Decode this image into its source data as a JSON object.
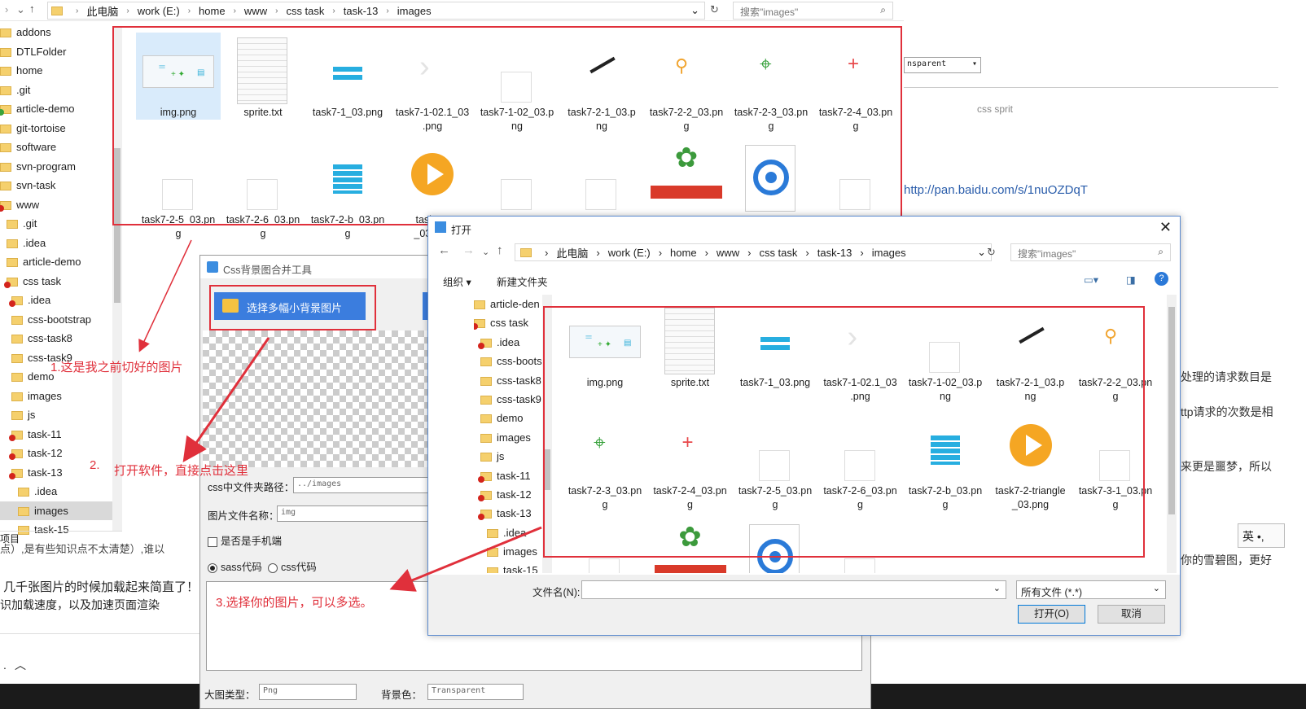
{
  "explorer": {
    "breadcrumbs": [
      "此电脑",
      "work (E:)",
      "home",
      "www",
      "css task",
      "task-13",
      "images"
    ],
    "search_placeholder": "搜索\"images\"",
    "tree": [
      {
        "label": "addons",
        "icon": "folder-icon"
      },
      {
        "label": "DTLFolder",
        "icon": "folder-icon"
      },
      {
        "label": "home",
        "icon": "folder-icon"
      },
      {
        "label": ".git",
        "icon": "folder-icon"
      },
      {
        "label": "article-demo",
        "icon": "folder-ok-icon"
      },
      {
        "label": "git-tortoise",
        "icon": "folder-icon"
      },
      {
        "label": "software",
        "icon": "folder-icon"
      },
      {
        "label": "svn-program",
        "icon": "folder-icon"
      },
      {
        "label": "svn-task",
        "icon": "folder-icon"
      },
      {
        "label": "www",
        "icon": "folder-warn-icon"
      },
      {
        "label": ".git",
        "icon": "folder-icon"
      },
      {
        "label": ".idea",
        "icon": "folder-icon"
      },
      {
        "label": "article-demo",
        "icon": "folder-icon"
      },
      {
        "label": "css task",
        "icon": "folder-warn-icon"
      },
      {
        "label": ".idea",
        "icon": "folder-warn-icon"
      },
      {
        "label": "css-bootstrap",
        "icon": "folder-icon"
      },
      {
        "label": "css-task8",
        "icon": "folder-icon"
      },
      {
        "label": "css-task9",
        "icon": "folder-icon"
      },
      {
        "label": "demo",
        "icon": "folder-icon"
      },
      {
        "label": "images",
        "icon": "folder-icon"
      },
      {
        "label": "js",
        "icon": "folder-icon"
      },
      {
        "label": "task-11",
        "icon": "folder-warn-icon"
      },
      {
        "label": "task-12",
        "icon": "folder-warn-icon"
      },
      {
        "label": "task-13",
        "icon": "folder-warn-icon"
      },
      {
        "label": ".idea",
        "icon": "folder-icon"
      },
      {
        "label": "images",
        "icon": "folder-icon"
      },
      {
        "label": "task-15",
        "icon": "folder-icon"
      }
    ],
    "status": "项目",
    "files": [
      {
        "name": "img.png",
        "thumb": "sprite-preview"
      },
      {
        "name": "sprite.txt",
        "thumb": "text-doc"
      },
      {
        "name": "task7-1_03.png",
        "thumb": "bars-icon"
      },
      {
        "name": "task7-1-02.1_03\n.png",
        "thumb": "chevron-icon"
      },
      {
        "name": "task7-1-02_03.p\nng",
        "thumb": "blank"
      },
      {
        "name": "task7-2-1_03.p\nng",
        "thumb": "pen-icon"
      },
      {
        "name": "task7-2-2_03.pn\ng",
        "thumb": "magnifier-icon"
      },
      {
        "name": "task7-2-3_03.pn\ng",
        "thumb": "crosshair-icon"
      },
      {
        "name": "task7-2-4_03.pn\ng",
        "thumb": "plus-icon"
      },
      {
        "name": "task7-2-5_03.pn\ng",
        "thumb": "blank"
      },
      {
        "name": "task7-2-6_03.pn\ng",
        "thumb": "blank"
      },
      {
        "name": "task7-2-b_03.pn\ng",
        "thumb": "list-icon"
      },
      {
        "name": "task7-2\n_03.png",
        "thumb": "play-icon"
      },
      {
        "name": "",
        "thumb": "blank"
      },
      {
        "name": "",
        "thumb": "blank"
      },
      {
        "name": "",
        "thumb": "trophy-icon"
      },
      {
        "name": "",
        "thumb": "target-icon"
      },
      {
        "name": "",
        "thumb": "blank"
      }
    ]
  },
  "background_doc": {
    "select_value": "nsparent",
    "caption": "css sprit",
    "link": "http://pan.baidu.com/s/1nuOZDqT",
    "lines": [
      "处理的请求数目是",
      "ttp请求的次数是相",
      "来更是噩梦，所以",
      "你的雪碧图，更好"
    ],
    "ime_label": "英 •,"
  },
  "left_text": {
    "line1": "点）,是有些知识点不太清楚）,谁以",
    "line2": "几千张图片的时候加载起来简直了！",
    "line3": "识加载速度，以及加速页面渲染"
  },
  "tool": {
    "title": "Css背景图合并工具",
    "pick_button": "选择多幅小背景图片",
    "css_path_label": "css中文件夹路径：",
    "css_path_value": "../images",
    "image_name_label": "图片文件名称：",
    "image_name_value": "img",
    "mobile_label": "是否是手机端",
    "sass_label": "sass代码",
    "css_label": "css代码",
    "bigimg_label": "大图类型：",
    "bigimg_value": "Png",
    "bg_label": "背景色：",
    "bg_value": "Transparent"
  },
  "dialog": {
    "title": "打开",
    "breadcrumbs": [
      "此电脑",
      "work (E:)",
      "home",
      "www",
      "css task",
      "task-13",
      "images"
    ],
    "search_placeholder": "搜索\"images\"",
    "organize": "组织 ▾",
    "new_folder": "新建文件夹",
    "tree": [
      {
        "label": "article-den",
        "icon": "folder-icon"
      },
      {
        "label": "css task",
        "icon": "folder-warn-icon"
      },
      {
        "label": ".idea",
        "icon": "folder-warn-icon"
      },
      {
        "label": "css-boots",
        "icon": "folder-icon"
      },
      {
        "label": "css-task8",
        "icon": "folder-icon"
      },
      {
        "label": "css-task9",
        "icon": "folder-icon"
      },
      {
        "label": "demo",
        "icon": "folder-icon"
      },
      {
        "label": "images",
        "icon": "folder-icon"
      },
      {
        "label": "js",
        "icon": "folder-icon"
      },
      {
        "label": "task-11",
        "icon": "folder-warn-icon"
      },
      {
        "label": "task-12",
        "icon": "folder-warn-icon"
      },
      {
        "label": "task-13",
        "icon": "folder-warn-icon"
      },
      {
        "label": ".idea",
        "icon": "folder-icon"
      },
      {
        "label": "images",
        "icon": "folder-icon"
      },
      {
        "label": "task-15",
        "icon": "folder-icon"
      }
    ],
    "files": [
      {
        "name": "img.png",
        "thumb": "sprite-preview"
      },
      {
        "name": "sprite.txt",
        "thumb": "text-doc"
      },
      {
        "name": "task7-1_03.png",
        "thumb": "bars-icon"
      },
      {
        "name": "task7-1-02.1_03\n.png",
        "thumb": "chevron-icon"
      },
      {
        "name": "task7-1-02_03.p\nng",
        "thumb": "blank"
      },
      {
        "name": "task7-2-1_03.p\nng",
        "thumb": "pen-icon"
      },
      {
        "name": "task7-2-2_03.pn\ng",
        "thumb": "magnifier-icon"
      },
      {
        "name": "task7-2-3_03.pn\ng",
        "thumb": "crosshair-icon"
      },
      {
        "name": "task7-2-4_03.pn\ng",
        "thumb": "plus-icon"
      },
      {
        "name": "task7-2-5_03.pn\ng",
        "thumb": "blank"
      },
      {
        "name": "task7-2-6_03.pn\ng",
        "thumb": "blank"
      },
      {
        "name": "task7-2-b_03.pn\ng",
        "thumb": "list-icon"
      },
      {
        "name": "task7-2-triangle\n_03.png",
        "thumb": "play-icon"
      },
      {
        "name": "task7-3-1_03.pn\ng",
        "thumb": "blank"
      },
      {
        "name": "",
        "thumb": "blank"
      },
      {
        "name": "",
        "thumb": "trophy-icon"
      },
      {
        "name": "",
        "thumb": "target-icon"
      },
      {
        "name": "",
        "thumb": "blank"
      }
    ],
    "filename_label": "文件名(N):",
    "filetype_value": "所有文件 (*.*)",
    "open_button": "打开(O)",
    "cancel_button": "取消"
  },
  "annotations": {
    "a1": "1.这是我之前切好的图片",
    "a2_num": "2.",
    "a2": "打开软件，直接点击这里",
    "a3": "3.选择你的图片，可以多选。"
  },
  "colors": {
    "annotation": "#e0303b",
    "accent": "#3b7dde",
    "folder": "#f5d06d"
  }
}
